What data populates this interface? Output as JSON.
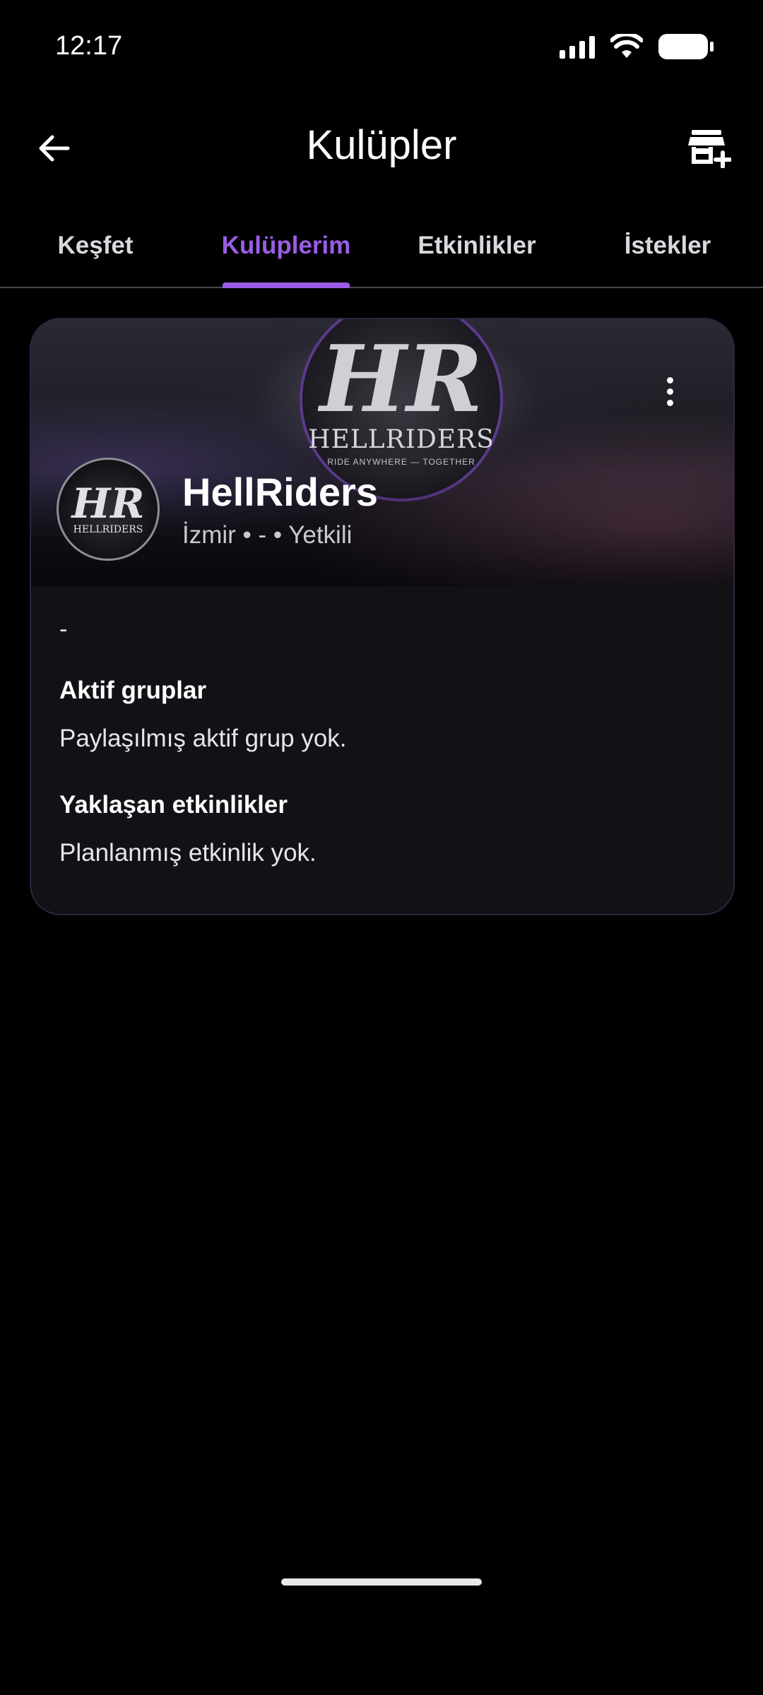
{
  "status_bar": {
    "time": "12:17"
  },
  "app_bar": {
    "title": "Kulüpler"
  },
  "tabs": [
    {
      "label": "Keşfet",
      "active": false
    },
    {
      "label": "Kulüplerim",
      "active": true
    },
    {
      "label": "Etkinlikler",
      "active": false
    },
    {
      "label": "İstekler",
      "active": false
    }
  ],
  "club_card": {
    "banner_logo_mark": "HR",
    "banner_logo_word": "HELLRIDERS",
    "banner_logo_tagline": "RIDE ANYWHERE — TOGETHER",
    "avatar_mark": "HR",
    "avatar_word": "HELLRIDERS",
    "name": "HellRiders",
    "meta": "İzmir • - • Yetkili",
    "description": "-",
    "active_groups_title": "Aktif gruplar",
    "active_groups_text": "Paylaşılmış aktif grup yok.",
    "upcoming_events_title": "Yaklaşan etkinlikler",
    "upcoming_events_text": "Planlanmış etkinlik yok."
  },
  "colors": {
    "accent": "#9b5de5",
    "background": "#000000",
    "card": "#121116"
  },
  "icons": {
    "back": "arrow-left-icon",
    "add_club": "add-store-icon",
    "more": "more-vertical-icon"
  }
}
